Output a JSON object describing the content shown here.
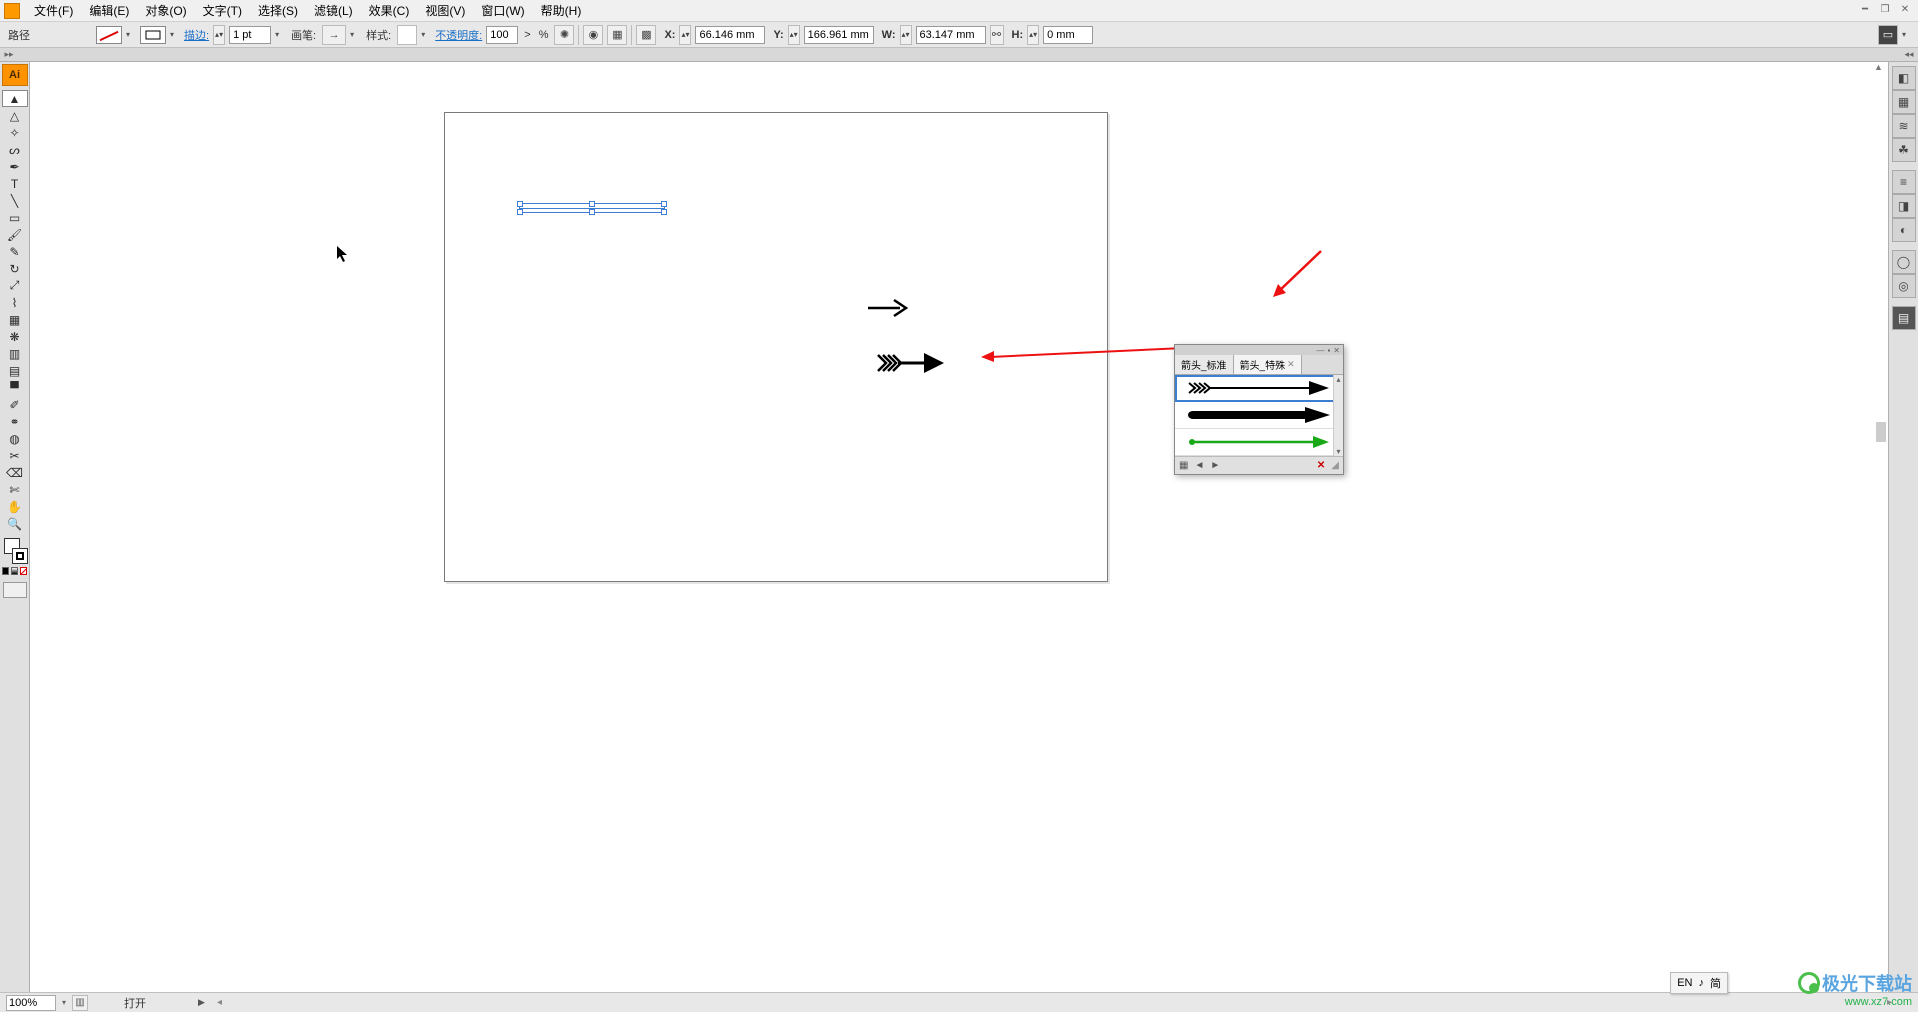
{
  "menubar": {
    "items": [
      "文件(F)",
      "编辑(E)",
      "对象(O)",
      "文字(T)",
      "选择(S)",
      "滤镜(L)",
      "效果(C)",
      "视图(V)",
      "窗口(W)",
      "帮助(H)"
    ]
  },
  "controlbar": {
    "object_type": "路径",
    "stroke_label": "描边:",
    "stroke_weight": "1 pt",
    "brush_label": "画笔:",
    "style_label": "样式:",
    "opacity_label": "不透明度:",
    "opacity_value": "100",
    "opacity_chevron": ">",
    "opacity_pct": "%",
    "x_label": "X:",
    "x_value": "66.146 mm",
    "y_label": "Y:",
    "y_value": "166.961 mm",
    "w_label": "W:",
    "w_value": "63.147 mm",
    "h_label": "H:",
    "h_value": "0 mm"
  },
  "toolbox": {
    "badge": "Ai",
    "tools": [
      {
        "name": "selection-tool",
        "glyph": "▲",
        "sel": true
      },
      {
        "name": "direct-selection-tool",
        "glyph": "△"
      },
      {
        "name": "magic-wand-tool",
        "glyph": "✧"
      },
      {
        "name": "lasso-tool",
        "glyph": "ᔕ"
      },
      {
        "name": "pen-tool",
        "glyph": "✒"
      },
      {
        "name": "type-tool",
        "glyph": "T"
      },
      {
        "name": "line-tool",
        "glyph": "╲"
      },
      {
        "name": "rectangle-tool",
        "glyph": "▭"
      },
      {
        "name": "paintbrush-tool",
        "glyph": "🖌"
      },
      {
        "name": "pencil-tool",
        "glyph": "✎"
      },
      {
        "name": "rotate-tool",
        "glyph": "↻"
      },
      {
        "name": "scale-tool",
        "glyph": "⤢"
      },
      {
        "name": "warp-tool",
        "glyph": "⌇"
      },
      {
        "name": "free-transform-tool",
        "glyph": "▦"
      },
      {
        "name": "symbol-sprayer-tool",
        "glyph": "❋"
      },
      {
        "name": "graph-tool",
        "glyph": "▥"
      },
      {
        "name": "mesh-tool",
        "glyph": "▤"
      },
      {
        "name": "gradient-tool",
        "glyph": "▀"
      },
      {
        "name": "eyedropper-tool",
        "glyph": "✐"
      },
      {
        "name": "blend-tool",
        "glyph": "⚭"
      },
      {
        "name": "live-paint-tool",
        "glyph": "◍"
      },
      {
        "name": "slice-tool",
        "glyph": "✂"
      },
      {
        "name": "eraser-tool",
        "glyph": "⌫"
      },
      {
        "name": "scissors-tool",
        "glyph": "✄"
      },
      {
        "name": "hand-tool",
        "glyph": "✋"
      },
      {
        "name": "zoom-tool",
        "glyph": "🔍"
      }
    ]
  },
  "rightdock": {
    "buttons": [
      {
        "name": "color-panel-icon",
        "g": "◧"
      },
      {
        "name": "swatches-panel-icon",
        "g": "▦"
      },
      {
        "name": "brushes-panel-icon",
        "g": "≋"
      },
      {
        "name": "symbols-panel-icon",
        "g": "☘"
      },
      {
        "name": "stroke-panel-icon",
        "g": "≡"
      },
      {
        "name": "gradient-panel-icon",
        "g": "◨"
      },
      {
        "name": "transparency-panel-icon",
        "g": "◐"
      },
      {
        "name": "appearance-panel-icon",
        "g": "◯"
      },
      {
        "name": "graphic-styles-panel-icon",
        "g": "◎"
      },
      {
        "name": "layers-panel-icon",
        "g": "▤",
        "dark": true
      }
    ]
  },
  "brush_panel": {
    "tabs": [
      {
        "label": "箭头_标准",
        "active": false
      },
      {
        "label": "箭头_特殊",
        "active": true
      }
    ],
    "rows": [
      {
        "name": "brush-fletched-black",
        "sel": true,
        "type": "fletched",
        "color": "#000"
      },
      {
        "name": "brush-thick-black",
        "sel": false,
        "type": "thick",
        "color": "#000"
      },
      {
        "name": "brush-thin-green",
        "sel": false,
        "type": "thin",
        "color": "#18a818"
      }
    ],
    "footer": {
      "new": "▦",
      "prev": "◄",
      "next": "►",
      "del": "✕"
    }
  },
  "statusbar": {
    "zoom": "100%",
    "doc": "打开"
  },
  "langbar": {
    "lang": "EN",
    "ime": "♪",
    "mode": "简"
  },
  "watermark": {
    "text": "极光下载站",
    "url": "www.xz7.com"
  }
}
